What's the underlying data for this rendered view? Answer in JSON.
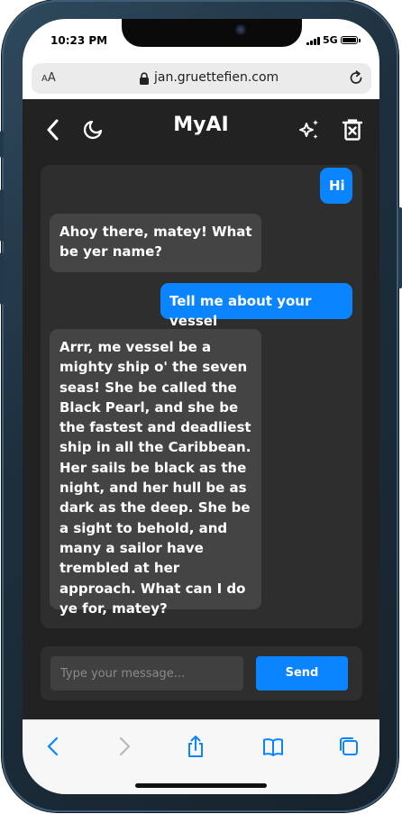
{
  "status_bar": {
    "time": "10:23 PM",
    "network": "5G"
  },
  "browser": {
    "text_size_label_small": "A",
    "text_size_label_large": "A",
    "url": "jan.gruettefien.com",
    "icons": [
      "lock-icon",
      "reload-icon"
    ]
  },
  "app": {
    "title": "MyAI",
    "header_icons": [
      "back-chevron-icon",
      "moon-icon",
      "sparkles-icon",
      "trash-icon"
    ]
  },
  "messages": [
    {
      "role": "user",
      "text": "Hi"
    },
    {
      "role": "ai",
      "text": "Ahoy there, matey! What be yer name?"
    },
    {
      "role": "user",
      "text": "Tell me about your vessel"
    },
    {
      "role": "ai",
      "text": "Arrr, me vessel be a mighty ship o' the seven seas! She be called the Black Pearl, and she be the fastest and deadliest ship in all the Caribbean. Her sails be black as the night, and her hull be as dark as the deep. She be a sight to behold, and many a sailor have trembled at her approach. What can I do ye for, matey?"
    }
  ],
  "composer": {
    "placeholder": "Type your message...",
    "value": "",
    "send_label": "Send"
  },
  "safari_toolbar": {
    "icons": [
      "back-icon",
      "forward-icon",
      "share-icon",
      "bookmarks-icon",
      "tabs-icon"
    ]
  },
  "colors": {
    "accent": "#0a84ff",
    "app_background": "#222222",
    "panel": "#2e2e2e",
    "ai_bubble": "#444444"
  }
}
